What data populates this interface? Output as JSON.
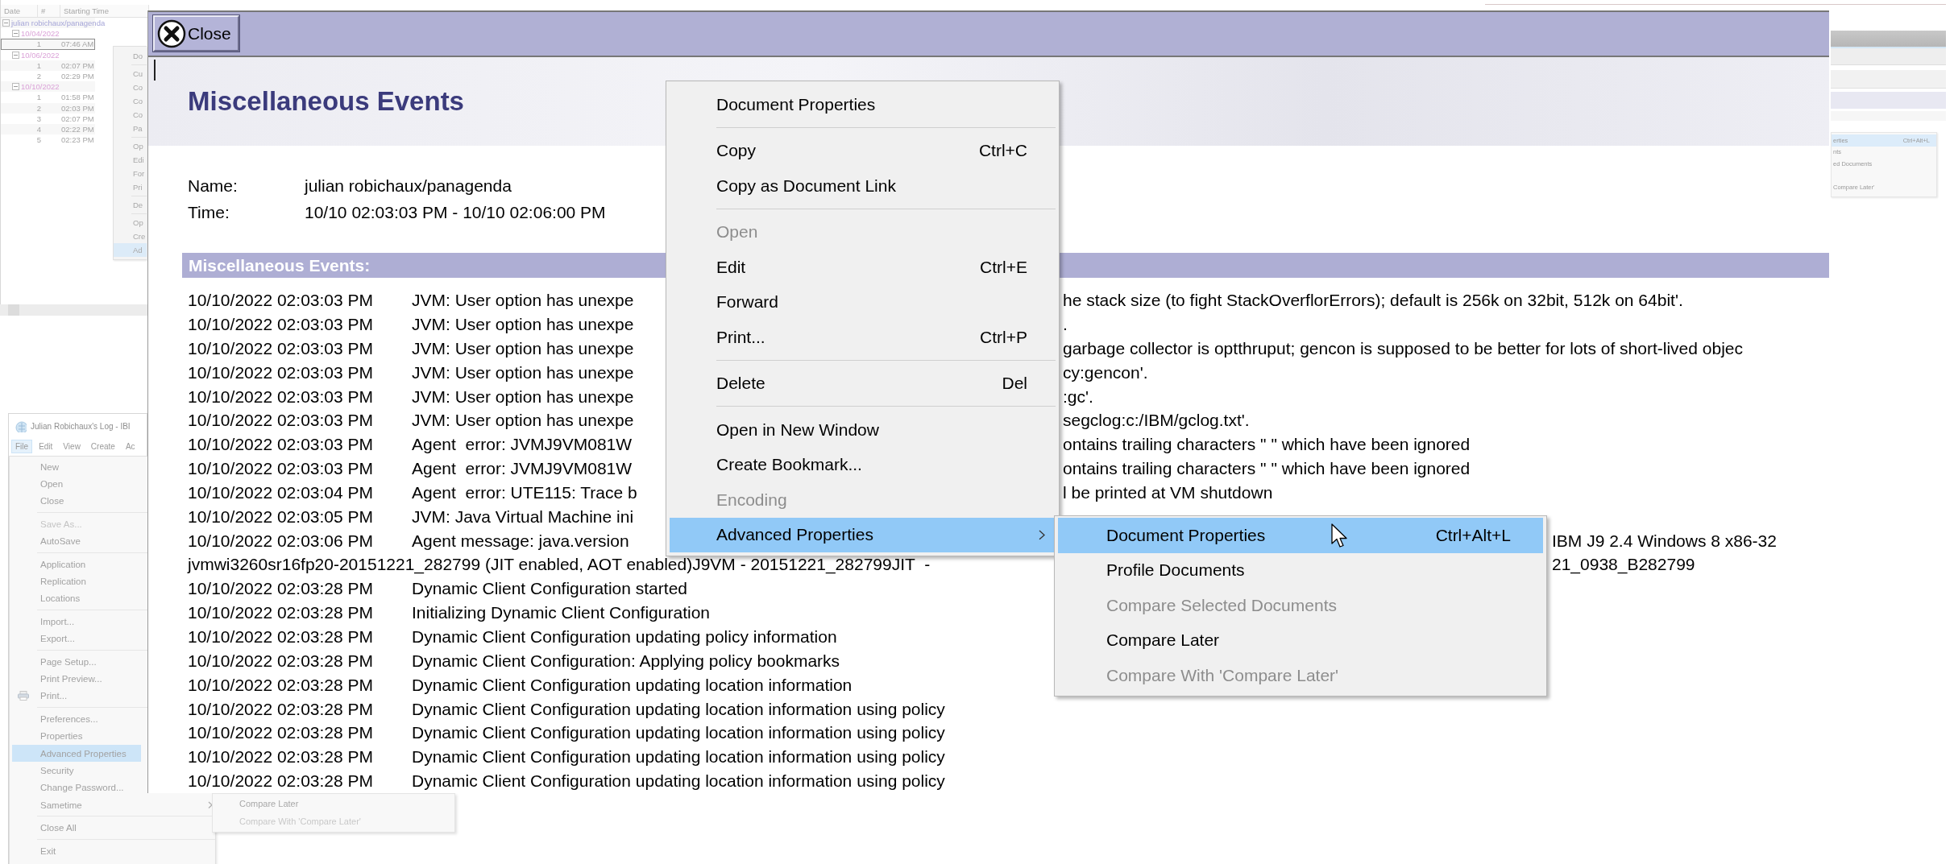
{
  "tree_window": {
    "columns": [
      "Date",
      "#",
      "Starting Time"
    ],
    "root": {
      "label": "julian robichaux/panagenda",
      "expanded": true,
      "children": [
        {
          "label": "10/04/2022",
          "expanded": true,
          "children": [
            {
              "number": "1",
              "time": "07:46 AM",
              "selected": true
            }
          ]
        },
        {
          "label": "10/06/2022",
          "expanded": true,
          "children": [
            {
              "number": "1",
              "time": "02:07 PM",
              "selected": false
            },
            {
              "number": "2",
              "time": "02:29 PM",
              "selected": false
            }
          ]
        },
        {
          "label": "10/10/2022",
          "expanded": true,
          "children": [
            {
              "number": "1",
              "time": "01:58 PM",
              "selected": false
            },
            {
              "number": "2",
              "time": "02:03 PM",
              "selected": false
            },
            {
              "number": "3",
              "time": "02:07 PM",
              "selected": false
            },
            {
              "number": "4",
              "time": "02:22 PM",
              "selected": false
            },
            {
              "number": "5",
              "time": "02:23 PM",
              "selected": false
            }
          ]
        }
      ]
    },
    "menu_fragments": [
      {
        "kind": "item",
        "label": "Do",
        "selected": false
      },
      {
        "kind": "separator"
      },
      {
        "kind": "item",
        "label": "Cu",
        "selected": false
      },
      {
        "kind": "item",
        "label": "Co",
        "selected": false
      },
      {
        "kind": "item",
        "label": "Co",
        "selected": false
      },
      {
        "kind": "item",
        "label": "Co",
        "selected": false
      },
      {
        "kind": "item",
        "label": "Pa",
        "selected": false
      },
      {
        "kind": "separator"
      },
      {
        "kind": "item",
        "label": "Op",
        "selected": false
      },
      {
        "kind": "item",
        "label": "Edi",
        "selected": false
      },
      {
        "kind": "item",
        "label": "For",
        "selected": false
      },
      {
        "kind": "item",
        "label": "Pri",
        "selected": false
      },
      {
        "kind": "separator"
      },
      {
        "kind": "item",
        "label": "De",
        "selected": false
      },
      {
        "kind": "separator"
      },
      {
        "kind": "item",
        "label": "Op",
        "selected": false
      },
      {
        "kind": "item",
        "label": "Cre",
        "selected": false
      },
      {
        "kind": "item",
        "label": "Ad",
        "selected": true
      }
    ]
  },
  "log_window": {
    "title": "Julian Robichaux's Log - IBI",
    "menu_bar": [
      {
        "label": "File",
        "selected": true
      },
      {
        "label": "Edit",
        "selected": false
      },
      {
        "label": "View",
        "selected": false
      },
      {
        "label": "Create",
        "selected": false
      },
      {
        "label": "Ac",
        "selected": false
      }
    ],
    "file_menu": [
      {
        "kind": "item",
        "label": "New",
        "disabled": false,
        "selected": false,
        "has_submenu": false
      },
      {
        "kind": "item",
        "label": "Open",
        "disabled": false,
        "selected": false,
        "has_submenu": false
      },
      {
        "kind": "item",
        "label": "Close",
        "disabled": false,
        "selected": false,
        "has_submenu": false
      },
      {
        "kind": "separator"
      },
      {
        "kind": "item",
        "label": "Save As...",
        "disabled": true,
        "selected": false,
        "has_submenu": false
      },
      {
        "kind": "item",
        "label": "AutoSave",
        "disabled": false,
        "selected": false,
        "has_submenu": false
      },
      {
        "kind": "separator"
      },
      {
        "kind": "item",
        "label": "Application",
        "disabled": false,
        "selected": false,
        "has_submenu": false
      },
      {
        "kind": "item",
        "label": "Replication",
        "disabled": false,
        "selected": false,
        "has_submenu": false
      },
      {
        "kind": "item",
        "label": "Locations",
        "disabled": false,
        "selected": false,
        "has_submenu": false
      },
      {
        "kind": "separator"
      },
      {
        "kind": "item",
        "label": "Import...",
        "disabled": false,
        "selected": false,
        "has_submenu": false
      },
      {
        "kind": "item",
        "label": "Export...",
        "disabled": false,
        "selected": false,
        "has_submenu": false
      },
      {
        "kind": "separator"
      },
      {
        "kind": "item",
        "label": "Page Setup...",
        "disabled": false,
        "selected": false,
        "has_submenu": false
      },
      {
        "kind": "item",
        "label": "Print Preview...",
        "disabled": false,
        "selected": false,
        "has_submenu": false
      },
      {
        "kind": "print-item",
        "label": "Print...",
        "disabled": false,
        "selected": false,
        "has_submenu": false
      },
      {
        "kind": "separator"
      },
      {
        "kind": "item",
        "label": "Preferences...",
        "disabled": false,
        "selected": false,
        "has_submenu": false
      },
      {
        "kind": "item",
        "label": "Properties",
        "disabled": false,
        "selected": false,
        "has_submenu": false
      },
      {
        "kind": "item",
        "label": "Advanced Properties",
        "disabled": false,
        "selected": true,
        "has_submenu": false
      },
      {
        "kind": "item",
        "label": "Security",
        "disabled": false,
        "selected": false,
        "has_submenu": false
      },
      {
        "kind": "item",
        "label": "Change Password...",
        "disabled": false,
        "selected": false,
        "has_submenu": false
      },
      {
        "kind": "item",
        "label": "Sametime",
        "disabled": false,
        "selected": false,
        "has_submenu": true
      },
      {
        "kind": "separator"
      },
      {
        "kind": "item",
        "label": "Close All",
        "disabled": false,
        "selected": false,
        "has_submenu": false
      },
      {
        "kind": "separator"
      },
      {
        "kind": "item",
        "label": "Exit",
        "disabled": false,
        "selected": false,
        "has_submenu": false
      }
    ],
    "submenu": [
      {
        "label": "Compare Later",
        "disabled": false
      },
      {
        "label": "Compare With 'Compare Later'",
        "disabled": true
      }
    ]
  },
  "document": {
    "close_button": "Close",
    "title": "Miscellaneous Events",
    "fields": [
      {
        "label": "Name:",
        "value": "julian robichaux/panagenda"
      },
      {
        "label": "Time:",
        "value": "10/10 02:03:03 PM - 10/10 02:06:00 PM"
      }
    ],
    "section_title": "Miscellaneous Events:",
    "log": [
      {
        "time": "10/10/2022 02:03:03 PM",
        "message": "JVM: User option has unexpe",
        "tail": "he stack size (to fight StackOverflorErrors); default is 256k on 32bit, 512k on 64bit'."
      },
      {
        "time": "10/10/2022 02:03:03 PM",
        "message": "JVM: User option has unexpe",
        "tail": "."
      },
      {
        "time": "10/10/2022 02:03:03 PM",
        "message": "JVM: User option has unexpe",
        "tail": "garbage collector is optthruput; gencon is supposed to be better for lots of short-lived objec"
      },
      {
        "time": "10/10/2022 02:03:03 PM",
        "message": "JVM: User option has unexpe",
        "tail": "cy:gencon'."
      },
      {
        "time": "10/10/2022 02:03:03 PM",
        "message": "JVM: User option has unexpe",
        "tail": ":gc'."
      },
      {
        "time": "10/10/2022 02:03:03 PM",
        "message": "JVM: User option has unexpe",
        "tail": "segclog:c:/IBM/gclog.txt'."
      },
      {
        "time": "10/10/2022 02:03:03 PM",
        "message": "Agent  error: JVMJ9VM081W",
        "tail": "ontains trailing characters \" \" which have been ignored"
      },
      {
        "time": "10/10/2022 02:03:03 PM",
        "message": "Agent  error: JVMJ9VM081W",
        "tail": "ontains trailing characters \" \" which have been ignored"
      },
      {
        "time": "10/10/2022 02:03:04 PM",
        "message": "Agent  error: UTE115: Trace b",
        "tail": "l be printed at VM shutdown"
      },
      {
        "time": "10/10/2022 02:03:05 PM",
        "message": "JVM: Java Virtual Machine ini"
      },
      {
        "time": "10/10/2022 02:03:06 PM",
        "message": "Agent message: java.version",
        "tail": "IBM J9 2.4 Windows 8 x86-32"
      },
      {
        "message": "jvmwi3260sr16fp20-20151221_282799 (JIT enabled, AOT enabled)J9VM - 20151221_282799JIT  -",
        "tail": "21_0938_B282799"
      },
      {
        "time": "10/10/2022 02:03:28 PM",
        "message": "Dynamic Client Configuration started"
      },
      {
        "time": "10/10/2022 02:03:28 PM",
        "message": "Initializing Dynamic Client Configuration"
      },
      {
        "time": "10/10/2022 02:03:28 PM",
        "message": "Dynamic Client Configuration updating policy information"
      },
      {
        "time": "10/10/2022 02:03:28 PM",
        "message": "Dynamic Client Configuration: Applying policy bookmarks"
      },
      {
        "time": "10/10/2022 02:03:28 PM",
        "message": "Dynamic Client Configuration updating location information"
      },
      {
        "time": "10/10/2022 02:03:28 PM",
        "message": "Dynamic Client Configuration updating location information using policy"
      },
      {
        "time": "10/10/2022 02:03:28 PM",
        "message": "Dynamic Client Configuration updating location information using policy"
      },
      {
        "time": "10/10/2022 02:03:28 PM",
        "message": "Dynamic Client Configuration updating location information using policy"
      },
      {
        "time": "10/10/2022 02:03:28 PM",
        "message": "Dynamic Client Configuration updating location information using policy"
      }
    ]
  },
  "context_menu": {
    "items": [
      {
        "kind": "item",
        "label": "Document Properties",
        "disabled": false,
        "selected": false,
        "has_submenu": false
      },
      {
        "kind": "separator"
      },
      {
        "kind": "item",
        "label": "Copy",
        "shortcut": "Ctrl+C",
        "disabled": false,
        "selected": false,
        "has_submenu": false
      },
      {
        "kind": "item",
        "label": "Copy as Document Link",
        "disabled": false,
        "selected": false,
        "has_submenu": false
      },
      {
        "kind": "separator"
      },
      {
        "kind": "item",
        "label": "Open",
        "disabled": true,
        "selected": false,
        "has_submenu": false
      },
      {
        "kind": "item",
        "label": "Edit",
        "shortcut": "Ctrl+E",
        "disabled": false,
        "selected": false,
        "has_submenu": false
      },
      {
        "kind": "item",
        "label": "Forward",
        "disabled": false,
        "selected": false,
        "has_submenu": false
      },
      {
        "kind": "item",
        "label": "Print...",
        "shortcut": "Ctrl+P",
        "disabled": false,
        "selected": false,
        "has_submenu": false
      },
      {
        "kind": "separator"
      },
      {
        "kind": "item",
        "label": "Delete",
        "shortcut": "Del",
        "disabled": false,
        "selected": false,
        "has_submenu": false
      },
      {
        "kind": "separator"
      },
      {
        "kind": "item",
        "label": "Open in New Window",
        "disabled": false,
        "selected": false,
        "has_submenu": false
      },
      {
        "kind": "item",
        "label": "Create Bookmark...",
        "disabled": false,
        "selected": false,
        "has_submenu": false
      },
      {
        "kind": "item",
        "label": "Encoding",
        "disabled": true,
        "selected": false,
        "has_submenu": false
      },
      {
        "kind": "item",
        "label": "Advanced Properties",
        "disabled": false,
        "selected": true,
        "has_submenu": true
      }
    ],
    "submenu": [
      {
        "kind": "item",
        "label": "Document Properties",
        "shortcut": "Ctrl+Alt+L",
        "disabled": false,
        "selected": true,
        "has_submenu": false
      },
      {
        "kind": "item",
        "label": "Profile Documents",
        "disabled": false,
        "selected": false,
        "has_submenu": false
      },
      {
        "kind": "item",
        "label": "Compare Selected Documents",
        "disabled": true,
        "selected": false,
        "has_submenu": false
      },
      {
        "kind": "item",
        "label": "Compare Later",
        "disabled": false,
        "selected": false,
        "has_submenu": false
      },
      {
        "kind": "item",
        "label": "Compare With 'Compare Later'",
        "disabled": true,
        "selected": false,
        "has_submenu": false
      }
    ]
  },
  "faded_menu": {
    "items": [
      {
        "label": "erties",
        "shortcut": "Ctrl+Alt+L",
        "selected": true
      },
      {
        "label": "nts",
        "selected": false
      },
      {
        "label": "ed Documents",
        "selected": false
      },
      {
        "label": "Compare Later'",
        "selected": false
      }
    ]
  }
}
